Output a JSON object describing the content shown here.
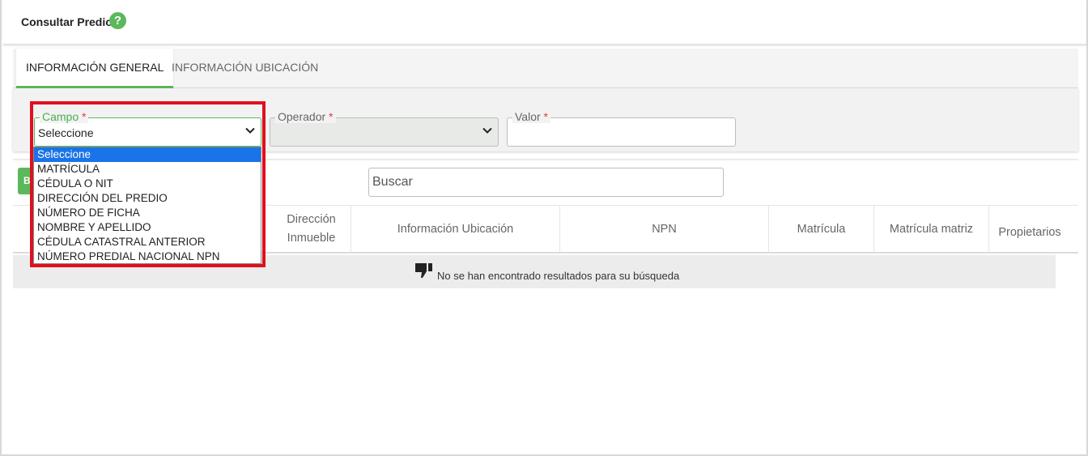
{
  "header": {
    "title": "Consultar Predio",
    "help_icon": "?"
  },
  "tabs": [
    {
      "label": "INFORMACIÓN GENERAL",
      "active": true
    },
    {
      "label": "INFORMACIÓN UBICACIÓN",
      "active": false
    }
  ],
  "filters": {
    "campo": {
      "label": "Campo",
      "required_mark": "*",
      "value": "Seleccione"
    },
    "operador": {
      "label": "Operador",
      "required_mark": "*",
      "value": ""
    },
    "valor": {
      "label": "Valor",
      "required_mark": "*",
      "value": ""
    }
  },
  "campo_options": [
    "Seleccione",
    "MATRÍCULA",
    "CÉDULA O NIT",
    "DIRECCIÓN DEL PREDIO",
    "NÚMERO DE FICHA",
    "NOMBRE Y APELLIDO",
    "CÉDULA CATASTRAL ANTERIOR",
    "NÚMERO PREDIAL NACIONAL NPN"
  ],
  "button_partial": "B",
  "search": {
    "placeholder": "Buscar"
  },
  "table": {
    "columns": [
      "Dirección Inmueble",
      "Información Ubicación",
      "NPN",
      "Matrícula",
      "Matrícula matriz",
      "Propietarios"
    ],
    "empty_message": "No se han encontrado resultados para su búsqueda"
  },
  "colors": {
    "accent_green": "#5cb85c",
    "highlight_red": "#e0101e",
    "selected_blue": "#1a73e8"
  }
}
